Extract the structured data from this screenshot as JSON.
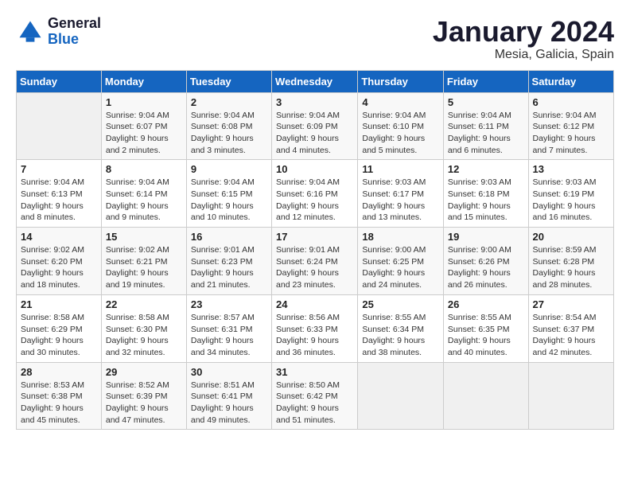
{
  "logo": {
    "line1": "General",
    "line2": "Blue"
  },
  "title": "January 2024",
  "location": "Mesia, Galicia, Spain",
  "days_header": [
    "Sunday",
    "Monday",
    "Tuesday",
    "Wednesday",
    "Thursday",
    "Friday",
    "Saturday"
  ],
  "weeks": [
    [
      {
        "day": "",
        "sunrise": "",
        "sunset": "",
        "daylight": ""
      },
      {
        "day": "1",
        "sunrise": "Sunrise: 9:04 AM",
        "sunset": "Sunset: 6:07 PM",
        "daylight": "Daylight: 9 hours and 2 minutes."
      },
      {
        "day": "2",
        "sunrise": "Sunrise: 9:04 AM",
        "sunset": "Sunset: 6:08 PM",
        "daylight": "Daylight: 9 hours and 3 minutes."
      },
      {
        "day": "3",
        "sunrise": "Sunrise: 9:04 AM",
        "sunset": "Sunset: 6:09 PM",
        "daylight": "Daylight: 9 hours and 4 minutes."
      },
      {
        "day": "4",
        "sunrise": "Sunrise: 9:04 AM",
        "sunset": "Sunset: 6:10 PM",
        "daylight": "Daylight: 9 hours and 5 minutes."
      },
      {
        "day": "5",
        "sunrise": "Sunrise: 9:04 AM",
        "sunset": "Sunset: 6:11 PM",
        "daylight": "Daylight: 9 hours and 6 minutes."
      },
      {
        "day": "6",
        "sunrise": "Sunrise: 9:04 AM",
        "sunset": "Sunset: 6:12 PM",
        "daylight": "Daylight: 9 hours and 7 minutes."
      }
    ],
    [
      {
        "day": "7",
        "sunrise": "Sunrise: 9:04 AM",
        "sunset": "Sunset: 6:13 PM",
        "daylight": "Daylight: 9 hours and 8 minutes."
      },
      {
        "day": "8",
        "sunrise": "Sunrise: 9:04 AM",
        "sunset": "Sunset: 6:14 PM",
        "daylight": "Daylight: 9 hours and 9 minutes."
      },
      {
        "day": "9",
        "sunrise": "Sunrise: 9:04 AM",
        "sunset": "Sunset: 6:15 PM",
        "daylight": "Daylight: 9 hours and 10 minutes."
      },
      {
        "day": "10",
        "sunrise": "Sunrise: 9:04 AM",
        "sunset": "Sunset: 6:16 PM",
        "daylight": "Daylight: 9 hours and 12 minutes."
      },
      {
        "day": "11",
        "sunrise": "Sunrise: 9:03 AM",
        "sunset": "Sunset: 6:17 PM",
        "daylight": "Daylight: 9 hours and 13 minutes."
      },
      {
        "day": "12",
        "sunrise": "Sunrise: 9:03 AM",
        "sunset": "Sunset: 6:18 PM",
        "daylight": "Daylight: 9 hours and 15 minutes."
      },
      {
        "day": "13",
        "sunrise": "Sunrise: 9:03 AM",
        "sunset": "Sunset: 6:19 PM",
        "daylight": "Daylight: 9 hours and 16 minutes."
      }
    ],
    [
      {
        "day": "14",
        "sunrise": "Sunrise: 9:02 AM",
        "sunset": "Sunset: 6:20 PM",
        "daylight": "Daylight: 9 hours and 18 minutes."
      },
      {
        "day": "15",
        "sunrise": "Sunrise: 9:02 AM",
        "sunset": "Sunset: 6:21 PM",
        "daylight": "Daylight: 9 hours and 19 minutes."
      },
      {
        "day": "16",
        "sunrise": "Sunrise: 9:01 AM",
        "sunset": "Sunset: 6:23 PM",
        "daylight": "Daylight: 9 hours and 21 minutes."
      },
      {
        "day": "17",
        "sunrise": "Sunrise: 9:01 AM",
        "sunset": "Sunset: 6:24 PM",
        "daylight": "Daylight: 9 hours and 23 minutes."
      },
      {
        "day": "18",
        "sunrise": "Sunrise: 9:00 AM",
        "sunset": "Sunset: 6:25 PM",
        "daylight": "Daylight: 9 hours and 24 minutes."
      },
      {
        "day": "19",
        "sunrise": "Sunrise: 9:00 AM",
        "sunset": "Sunset: 6:26 PM",
        "daylight": "Daylight: 9 hours and 26 minutes."
      },
      {
        "day": "20",
        "sunrise": "Sunrise: 8:59 AM",
        "sunset": "Sunset: 6:28 PM",
        "daylight": "Daylight: 9 hours and 28 minutes."
      }
    ],
    [
      {
        "day": "21",
        "sunrise": "Sunrise: 8:58 AM",
        "sunset": "Sunset: 6:29 PM",
        "daylight": "Daylight: 9 hours and 30 minutes."
      },
      {
        "day": "22",
        "sunrise": "Sunrise: 8:58 AM",
        "sunset": "Sunset: 6:30 PM",
        "daylight": "Daylight: 9 hours and 32 minutes."
      },
      {
        "day": "23",
        "sunrise": "Sunrise: 8:57 AM",
        "sunset": "Sunset: 6:31 PM",
        "daylight": "Daylight: 9 hours and 34 minutes."
      },
      {
        "day": "24",
        "sunrise": "Sunrise: 8:56 AM",
        "sunset": "Sunset: 6:33 PM",
        "daylight": "Daylight: 9 hours and 36 minutes."
      },
      {
        "day": "25",
        "sunrise": "Sunrise: 8:55 AM",
        "sunset": "Sunset: 6:34 PM",
        "daylight": "Daylight: 9 hours and 38 minutes."
      },
      {
        "day": "26",
        "sunrise": "Sunrise: 8:55 AM",
        "sunset": "Sunset: 6:35 PM",
        "daylight": "Daylight: 9 hours and 40 minutes."
      },
      {
        "day": "27",
        "sunrise": "Sunrise: 8:54 AM",
        "sunset": "Sunset: 6:37 PM",
        "daylight": "Daylight: 9 hours and 42 minutes."
      }
    ],
    [
      {
        "day": "28",
        "sunrise": "Sunrise: 8:53 AM",
        "sunset": "Sunset: 6:38 PM",
        "daylight": "Daylight: 9 hours and 45 minutes."
      },
      {
        "day": "29",
        "sunrise": "Sunrise: 8:52 AM",
        "sunset": "Sunset: 6:39 PM",
        "daylight": "Daylight: 9 hours and 47 minutes."
      },
      {
        "day": "30",
        "sunrise": "Sunrise: 8:51 AM",
        "sunset": "Sunset: 6:41 PM",
        "daylight": "Daylight: 9 hours and 49 minutes."
      },
      {
        "day": "31",
        "sunrise": "Sunrise: 8:50 AM",
        "sunset": "Sunset: 6:42 PM",
        "daylight": "Daylight: 9 hours and 51 minutes."
      },
      {
        "day": "",
        "sunrise": "",
        "sunset": "",
        "daylight": ""
      },
      {
        "day": "",
        "sunrise": "",
        "sunset": "",
        "daylight": ""
      },
      {
        "day": "",
        "sunrise": "",
        "sunset": "",
        "daylight": ""
      }
    ]
  ]
}
